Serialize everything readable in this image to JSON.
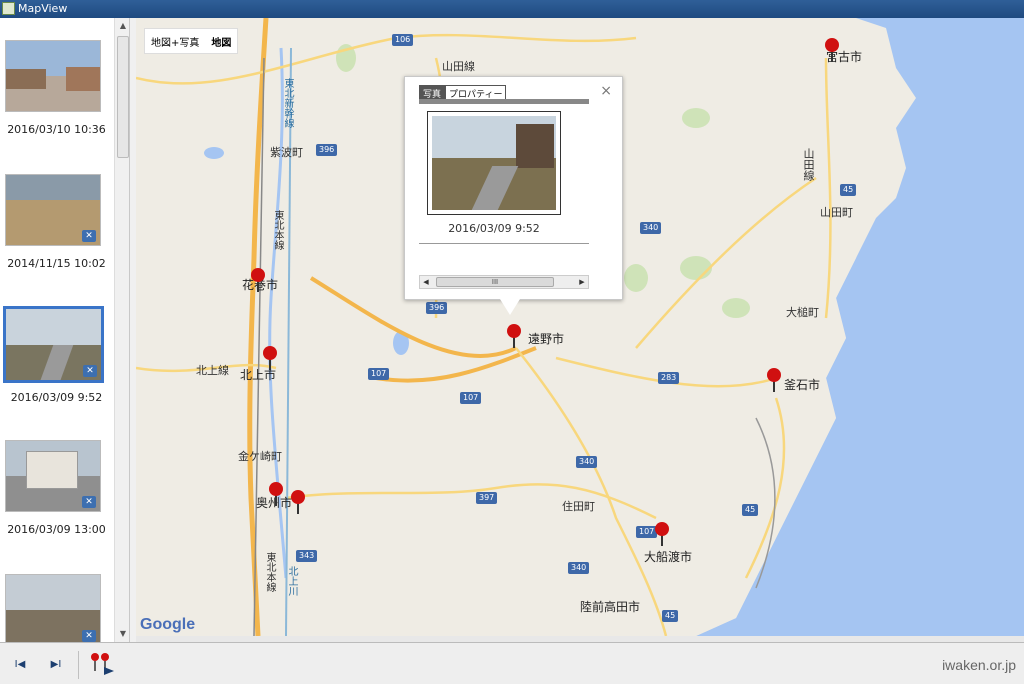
{
  "window": {
    "title": "MapView"
  },
  "sidebar": {
    "items": [
      {
        "date": "2016/03/10 10:36",
        "gps": false,
        "selected": false
      },
      {
        "date": "2014/11/15 10:02",
        "gps": true,
        "selected": false
      },
      {
        "date": "2016/03/09 9:52",
        "gps": true,
        "selected": true
      },
      {
        "date": "2016/03/09 13:00",
        "gps": true,
        "selected": false
      },
      {
        "date": "",
        "gps": true,
        "selected": false
      }
    ]
  },
  "map": {
    "type_controls": {
      "hybrid": "地図+写真",
      "map": "地図"
    },
    "labels": {
      "yamada_line": "山田線",
      "shiwa": "紫波町",
      "hanamaki": "花巻市",
      "kitakami_line": "北上線",
      "kitakami": "北上市",
      "tono": "遠野市",
      "kanegasaki": "金ケ崎町",
      "oshu": "奥州市",
      "sumita": "住田町",
      "ofunato": "大船渡市",
      "rikuzentakata": "陸前高田市",
      "yamada_town": "山田町",
      "otsuchi": "大槌町",
      "kamaishi": "釜石市",
      "miyako": "宮古市",
      "yamada_line_coast": "山田線",
      "tohoku_shinkansen": "東北新幹線",
      "tohoku_main": "東北本線",
      "tohoku_main_south": "東北本線",
      "kitakami_river": "北上川"
    },
    "routes": [
      "106",
      "396",
      "396",
      "340",
      "340",
      "107",
      "107",
      "283",
      "45",
      "45",
      "45",
      "343",
      "397",
      "340",
      "107"
    ],
    "google": "Google"
  },
  "popup": {
    "tabs": [
      "写真",
      "プロパティー"
    ],
    "close": "×",
    "date": "2016/03/09 9:52",
    "scroll_thumb": "III"
  },
  "bottom": {
    "prev_label": "I◀",
    "next_label": "▶I",
    "watermark": "iwaken.or.jp"
  }
}
